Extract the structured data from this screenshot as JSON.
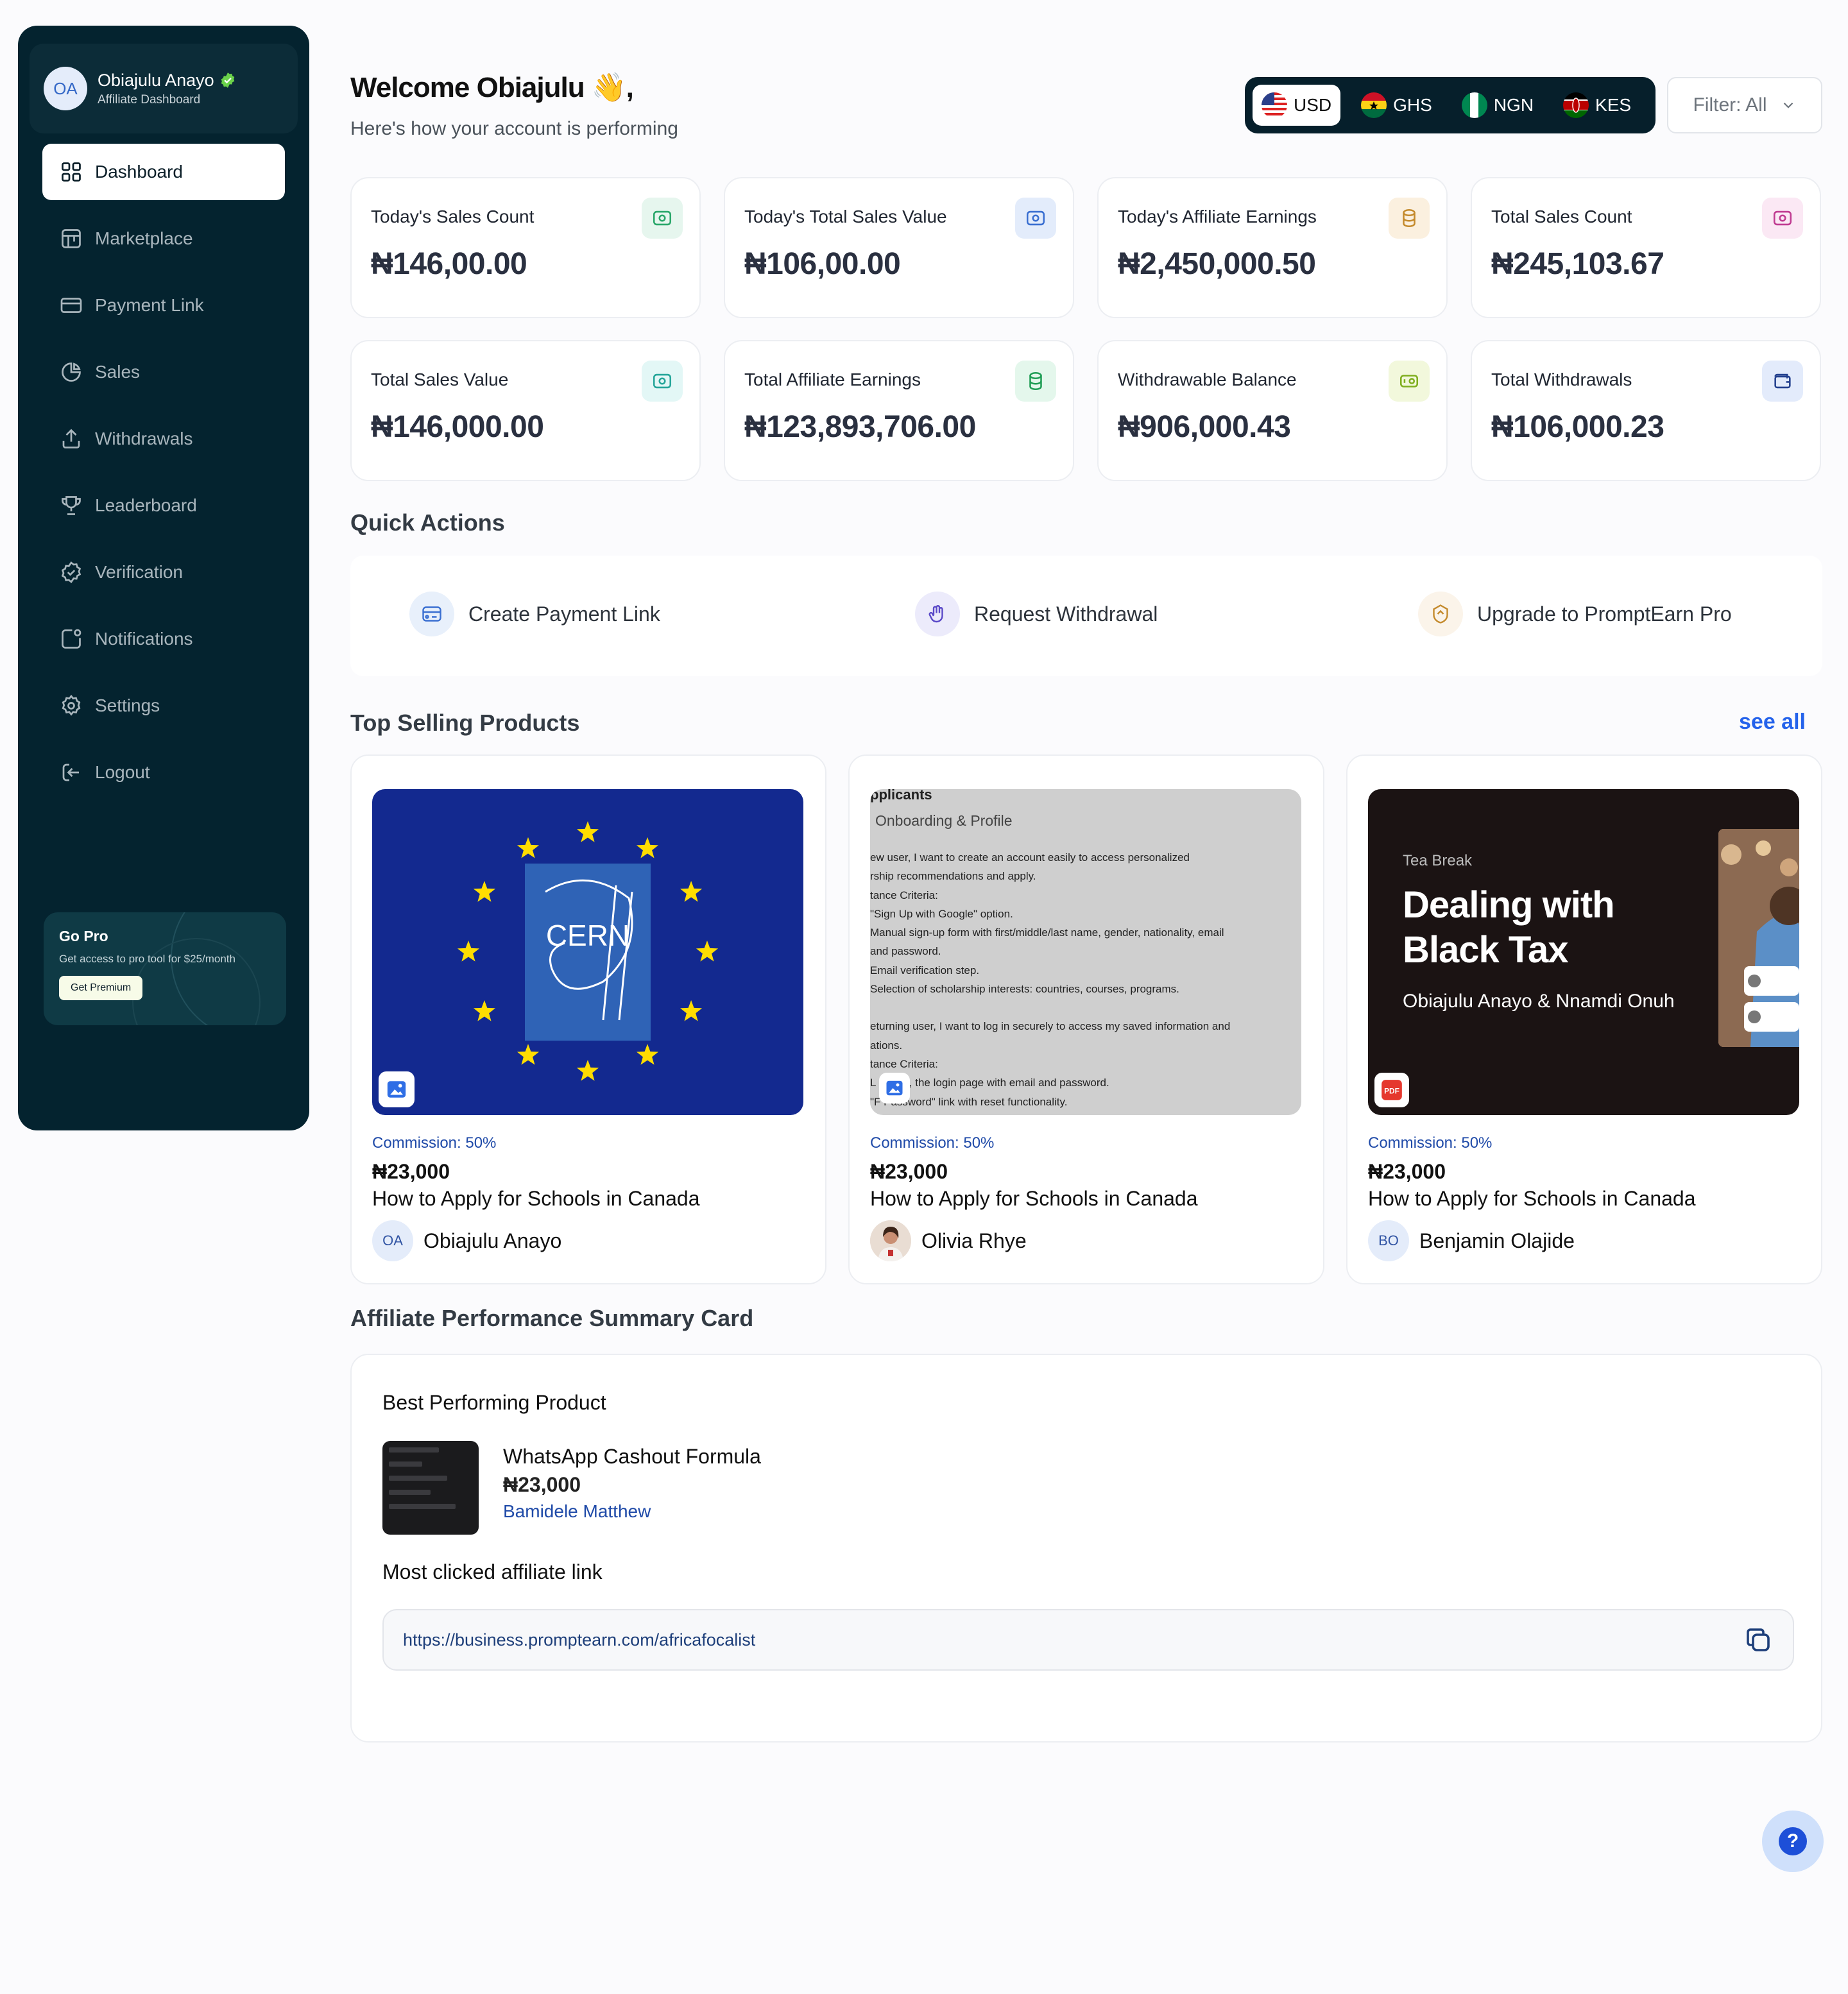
{
  "user": {
    "initials": "OA",
    "name": "Obiajulu Anayo",
    "subtitle": "Affiliate Dashboard"
  },
  "sidebar": {
    "items": [
      {
        "label": "Dashboard",
        "icon": "grid-icon",
        "active": true
      },
      {
        "label": "Marketplace",
        "icon": "store-icon"
      },
      {
        "label": "Payment Link",
        "icon": "card-icon"
      },
      {
        "label": "Sales",
        "icon": "pie-chart-icon"
      },
      {
        "label": "Withdrawals",
        "icon": "upload-icon"
      },
      {
        "label": "Leaderboard",
        "icon": "trophy-icon"
      },
      {
        "label": "Verification",
        "icon": "badge-check-icon"
      },
      {
        "label": "Notifications",
        "icon": "notification-icon"
      },
      {
        "label": "Settings",
        "icon": "gear-icon"
      },
      {
        "label": "Logout",
        "icon": "logout-icon"
      }
    ],
    "gopro": {
      "title": "Go Pro",
      "subtitle": "Get access to pro tool for $25/month",
      "button": "Get Premium"
    }
  },
  "header": {
    "welcome": "Welcome Obiajulu 👋,",
    "subtitle": "Here's how your account is performing",
    "currencies": [
      "USD",
      "GHS",
      "NGN",
      "KES"
    ],
    "selected_currency": "USD",
    "filter": "Filter: All"
  },
  "stats": [
    {
      "label": "Today's Sales Count",
      "value": "₦146,00.00",
      "color": "#e6f6ee",
      "icon": "money-icon"
    },
    {
      "label": "Today's Total Sales Value",
      "value": "₦106,00.00",
      "color": "#e3ecfb",
      "icon": "money-icon"
    },
    {
      "label": "Today's Affiliate Earnings",
      "value": "₦2,450,000.50",
      "color": "#fbf0df",
      "icon": "coins-icon"
    },
    {
      "label": "Total Sales Count",
      "value": "₦245,103.67",
      "color": "#fbe8f4",
      "icon": "money-icon"
    },
    {
      "label": "Total Sales Value",
      "value": "₦146,000.00",
      "color": "#e3f7f6",
      "icon": "money-icon"
    },
    {
      "label": "Total Affiliate Earnings",
      "value": "₦123,893,706.00",
      "color": "#e4f7ec",
      "icon": "coins-icon"
    },
    {
      "label": "Withdrawable Balance",
      "value": "₦906,000.43",
      "color": "#f2f8dc",
      "icon": "cash-icon"
    },
    {
      "label": "Total Withdrawals",
      "value": "₦106,000.23",
      "color": "#e3ebfb",
      "icon": "wallet-icon"
    }
  ],
  "quick_actions": {
    "title": "Quick Actions",
    "items": [
      "Create Payment Link",
      "Request Withdrawal",
      "Upgrade to PromptEarn Pro"
    ]
  },
  "top_products": {
    "title": "Top Selling Products",
    "see_all": "see all",
    "items": [
      {
        "commission": "Commission: 50%",
        "price": "₦23,000",
        "title": "How to Apply for Schools in Canada",
        "author": "Obiajulu Anayo",
        "initials": "OA",
        "badge": "image-icon",
        "image_text": "CERN"
      },
      {
        "commission": "Commission: 50%",
        "price": "₦23,000",
        "title": "How to Apply for Schools in Canada",
        "author": "Olivia Rhye",
        "initials": "",
        "badge": "image-icon",
        "doc_lines": [
          "pplicants",
          "Onboarding & Profile",
          "ew user, I want to create an account easily to access personalized",
          "rship recommendations and apply.",
          "tance Criteria:",
          "\"Sign Up with Google\" option.",
          "Manual sign-up form with first/middle/last name, gender, nationality, email",
          "and password.",
          "Email verification step.",
          "Selection of scholarship interests: countries, courses, programs.",
          "eturning user, I want to log in securely to access my saved information and",
          "ations.",
          "tance Criteria:",
          "L  button, the login page with email and password.",
          "\"F  Password\" link with reset functionality."
        ]
      },
      {
        "commission": "Commission: 50%",
        "price": "₦23,000",
        "title": "How to Apply for Schools in Canada",
        "author": "Benjamin Olajide",
        "initials": "BO",
        "badge": "pdf-icon",
        "cover": {
          "kicker": "Tea Break",
          "headline_1": "Dealing with",
          "headline_2": "Black Tax",
          "authors": "Obiajulu Anayo  & Nnamdi Onuh"
        }
      }
    ]
  },
  "summary": {
    "title": "Affiliate Performance Summary Card",
    "best_label": "Best Performing Product",
    "product_name": "WhatsApp Cashout Formula",
    "product_price": "₦23,000",
    "seller": "Bamidele Matthew",
    "link_label": "Most clicked affiliate link",
    "link": "https://business.promptearn.com/africafocalist"
  },
  "help": "?"
}
